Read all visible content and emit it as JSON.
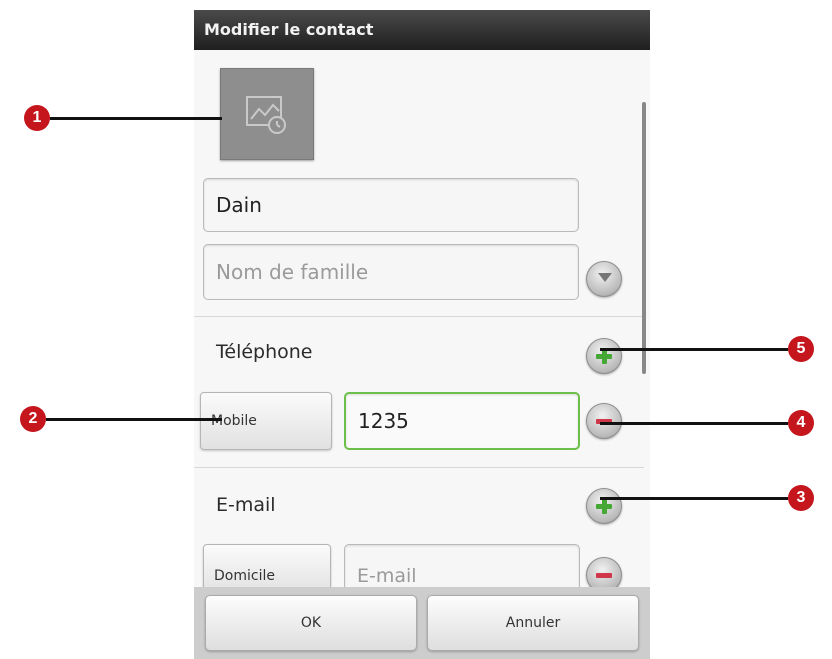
{
  "window": {
    "title": "Modifier le contact"
  },
  "contact": {
    "first_name": "Dain",
    "last_name_placeholder": "Nom de famille"
  },
  "phone": {
    "section_label": "Téléphone",
    "type_label": "Mobile",
    "value": "1235"
  },
  "email": {
    "section_label": "E-mail",
    "type_label": "Domicile",
    "placeholder": "E-mail"
  },
  "actions": {
    "ok_label": "OK",
    "cancel_label": "Annuler"
  },
  "callouts": [
    "1",
    "2",
    "3",
    "4",
    "5"
  ],
  "colors": {
    "add_icon": "#45a834",
    "remove_icon": "#d0384a",
    "focused_border": "#6cc04a",
    "callout_badge": "#c4161c"
  },
  "icons": [
    "contact-photo-icon",
    "expand-chevron-icon",
    "add-phone-icon",
    "remove-phone-icon",
    "add-email-icon",
    "remove-email-icon"
  ]
}
